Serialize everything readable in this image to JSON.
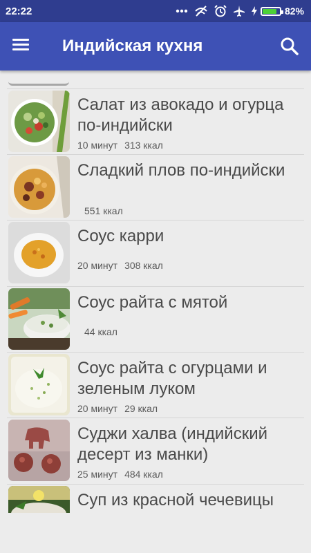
{
  "status_bar": {
    "time": "22:22",
    "battery_percent": "82%",
    "battery_level": 0.82,
    "icons": [
      "more-dots-icon",
      "data-off-icon",
      "alarm-icon",
      "airplane-icon",
      "charging-icon",
      "battery-icon"
    ]
  },
  "app_bar": {
    "title": "Индийская кухня",
    "menu_icon": "hamburger-menu-icon",
    "search_icon": "search-icon"
  },
  "recipes": [
    {
      "name": "Салат из авокадо и огурца по-индийски",
      "time": "10 минут",
      "calories": "313 ккал"
    },
    {
      "name": "Сладкий плов по-индийски",
      "time": "",
      "calories": "551 ккал"
    },
    {
      "name": "Соус карри",
      "time": "20 минут",
      "calories": "308 ккал"
    },
    {
      "name": "Соус райта с мятой",
      "time": "",
      "calories": "44 ккал"
    },
    {
      "name": "Соус райта с огурцами и зеленым луком",
      "time": "20 минут",
      "calories": "29 ккал"
    },
    {
      "name": "Суджи халва (индийский десерт из манки)",
      "time": "25 минут",
      "calories": "484 ккал"
    },
    {
      "name": "Суп из красной чечевицы",
      "time": "",
      "calories": ""
    }
  ]
}
